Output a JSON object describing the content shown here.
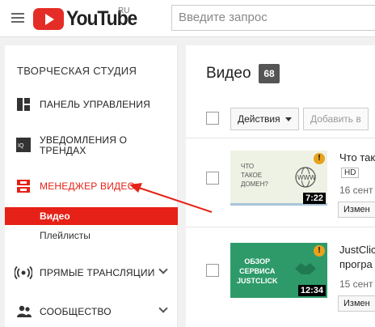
{
  "header": {
    "logo_text": "YouTube",
    "region": "RU",
    "search_placeholder": "Введите запрос"
  },
  "sidebar": {
    "heading": "ТВОРЧЕСКАЯ СТУДИЯ",
    "items": [
      {
        "label": "ПАНЕЛЬ УПРАВЛЕНИЯ",
        "icon": "dashboard-icon"
      },
      {
        "label_line1": "УВЕДОМЛЕНИЯ О",
        "label_line2": "ТРЕНДАХ",
        "icon": "trends-icon"
      },
      {
        "label": "МЕНЕДЖЕР ВИДЕО",
        "icon": "video-manager-icon"
      },
      {
        "label": "ПРЯМЫЕ ТРАНСЛЯЦИИ",
        "icon": "live-icon"
      },
      {
        "label": "СООБЩЕСТВО",
        "icon": "community-icon"
      }
    ],
    "subitems": [
      {
        "label": "Видео",
        "active": true
      },
      {
        "label": "Плейлисты",
        "active": false
      }
    ]
  },
  "main": {
    "title": "Видео",
    "count": "68",
    "actions_label": "Действия",
    "add_label": "Добавить в",
    "videos": [
      {
        "thumb_text": [
          "ЧТО",
          "ТАКОЕ",
          "ДОМЕН?"
        ],
        "thumb_www": "WWW",
        "duration": "7:22",
        "title": "Что так",
        "hd": "HD",
        "date": "16 сент",
        "edit": "Измен"
      },
      {
        "thumb_text": [
          "ОБЗОР",
          "СЕРВИСА",
          "JUSTCLICK"
        ],
        "duration": "12:34",
        "title_line1": "JustClick",
        "title_line2": "програ",
        "date": "15 сент",
        "edit": "Измен"
      }
    ]
  },
  "colors": {
    "accent": "#e52d27",
    "active_bg": "#e62117",
    "thumb1_bg": "#eef2e4",
    "thumb2_bg": "#2e9a6a",
    "warning": "#e8a21c"
  }
}
